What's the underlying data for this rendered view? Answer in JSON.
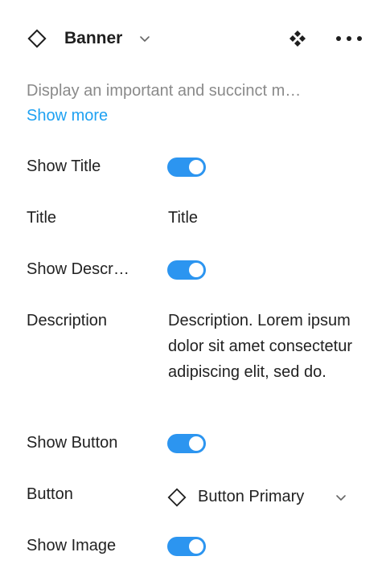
{
  "header": {
    "component_icon": "component-diamond-icon",
    "title": "Banner",
    "chevron_icon": "chevron-down-icon",
    "instance_icon": "instance-components-icon",
    "more_icon": "more-horizontal-icon"
  },
  "description": {
    "text": "Display an important and succinct m…",
    "show_more": "Show more"
  },
  "properties": {
    "show_title": {
      "label": "Show Title",
      "enabled": true
    },
    "title": {
      "label": "Title",
      "value": "Title"
    },
    "show_description": {
      "label": "Show Descr…",
      "enabled": true
    },
    "description": {
      "label": "Description",
      "value": "Description. Lorem ipsum dolor sit amet consectetur adipiscing elit, sed do."
    },
    "show_button": {
      "label": "Show Button",
      "enabled": true
    },
    "button": {
      "label": "Button",
      "value": "Button Primary",
      "icon": "component-diamond-icon",
      "chevron_icon": "chevron-down-icon"
    },
    "show_image": {
      "label": "Show Image",
      "enabled": true
    }
  },
  "colors": {
    "accent": "#2c95f0",
    "link": "#1ea1f2",
    "muted_text": "#8a8a8a",
    "text": "#222222"
  }
}
